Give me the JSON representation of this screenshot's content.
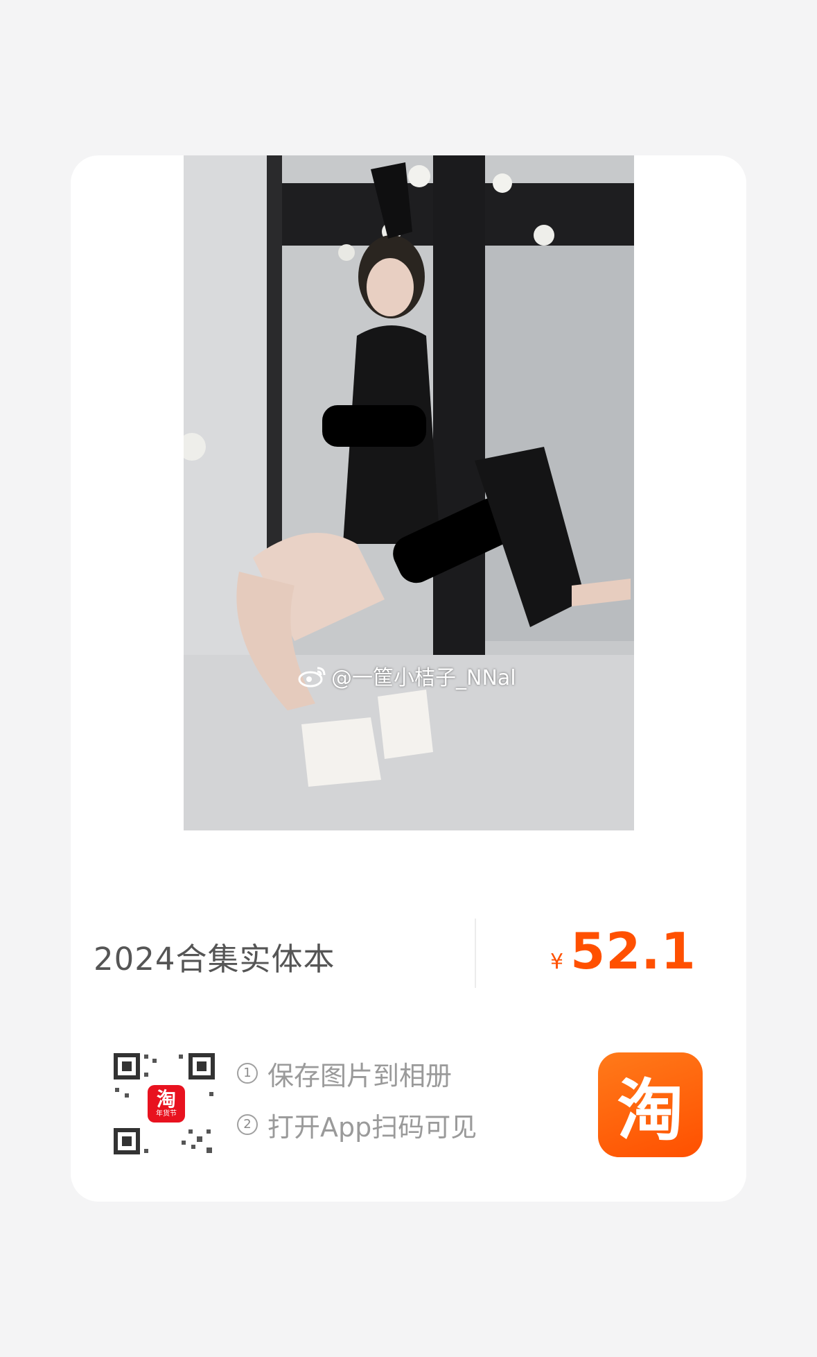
{
  "watermark": {
    "text": "@一筐小桔子_NNal",
    "icon": "weibo-icon"
  },
  "product": {
    "title": "2024合集实体本",
    "currency": "¥",
    "price": "52.1"
  },
  "qr": {
    "badge_text": "淘",
    "badge_sub": "年货节",
    "badge_color": "#e8121f"
  },
  "steps": [
    {
      "num": "1",
      "text": "保存图片到相册"
    },
    {
      "num": "2",
      "text": "打开App扫码可见"
    }
  ],
  "brand": {
    "logo_text": "淘",
    "accent": "#ff5000"
  }
}
